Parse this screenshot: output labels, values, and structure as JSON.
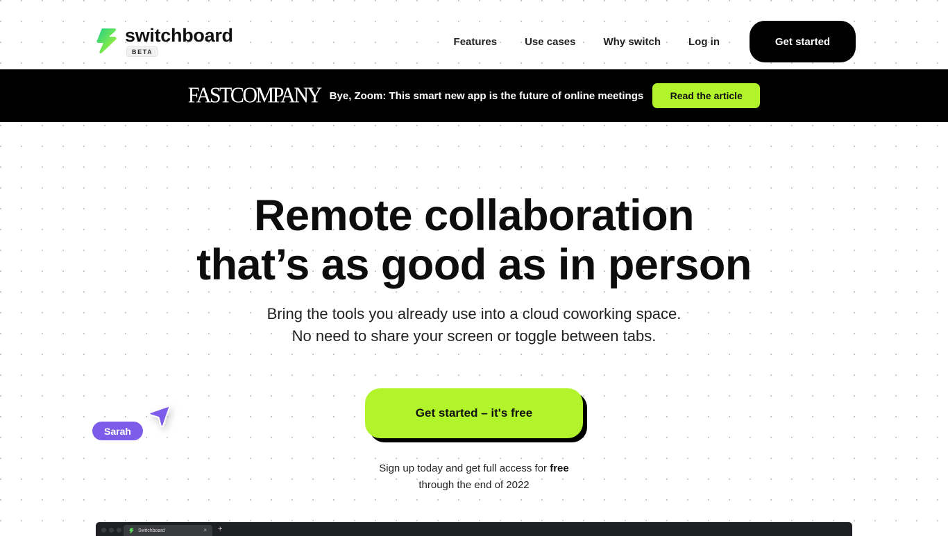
{
  "brand": {
    "name": "switchboard",
    "badge": "BETA",
    "accent_color": "#b2f42c",
    "cursor_color": "#7c5ce8"
  },
  "nav": {
    "items": [
      {
        "label": "Features"
      },
      {
        "label": "Use cases"
      },
      {
        "label": "Why switch"
      },
      {
        "label": "Log in"
      }
    ],
    "cta_label": "Get started"
  },
  "banner": {
    "publication": "FASTCOMPANY",
    "headline": "Bye, Zoom: This smart new app is the future of online meetings",
    "button_label": "Read the article"
  },
  "hero": {
    "title_line1": "Remote collaboration",
    "title_line2": "that’s as good as in person",
    "subtitle_line1": "Bring the tools you already use into a cloud coworking space.",
    "subtitle_line2": "No need to share your screen or toggle between tabs.",
    "cta_label": "Get started – it's free",
    "signup_text_before": "Sign up today and get full access for ",
    "signup_text_bold": "free",
    "signup_text_after": "through the end of 2022"
  },
  "cursor": {
    "user_name": "Sarah",
    "icon": "cursor-arrow-icon"
  },
  "app_preview": {
    "tab_title": "Switchboard",
    "tab_close": "×",
    "new_tab": "+"
  }
}
